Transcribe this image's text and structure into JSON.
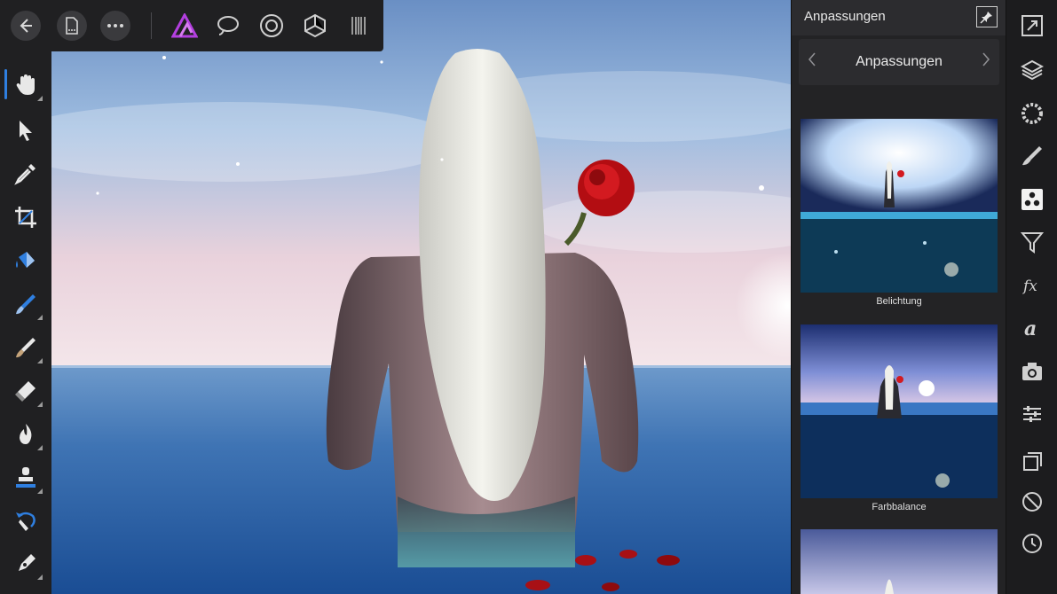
{
  "top_toolbar": {
    "buttons": [
      "back-icon",
      "document-icon",
      "more-icon"
    ],
    "personas": [
      "photo-persona-icon",
      "liquify-persona-icon",
      "develop-persona-icon",
      "tone-mapping-persona-icon",
      "export-persona-icon"
    ]
  },
  "left_toolbar": {
    "tools": [
      "hand-icon",
      "move-icon",
      "color-picker-icon",
      "crop-icon",
      "flood-fill-icon",
      "selection-brush-icon",
      "paint-brush-icon",
      "erase-brush-icon",
      "burn-icon",
      "clone-icon",
      "undo-brush-icon",
      "pen-icon"
    ],
    "active_tool": "hand-icon"
  },
  "panel": {
    "title": "Anpassungen",
    "category": "Anpassungen",
    "presets": [
      {
        "label": "Belichtung"
      },
      {
        "label": "Farbbalance"
      },
      {
        "label": ""
      }
    ]
  },
  "studio_bar": {
    "icons": [
      "navigator-icon",
      "layers-icon",
      "color-icon",
      "brushes-icon",
      "adjustments-icon",
      "filters-icon",
      "effects-icon",
      "styles-icon",
      "stock-icon",
      "transform-icon",
      "channels-icon",
      "no-icon",
      "history-icon"
    ],
    "active": "adjustments-icon"
  },
  "colors": {
    "accent": "#2f7fe0",
    "affinity_purple": "#b33fe0",
    "panel_bg": "#232325",
    "toolbar_bg": "#202022"
  }
}
